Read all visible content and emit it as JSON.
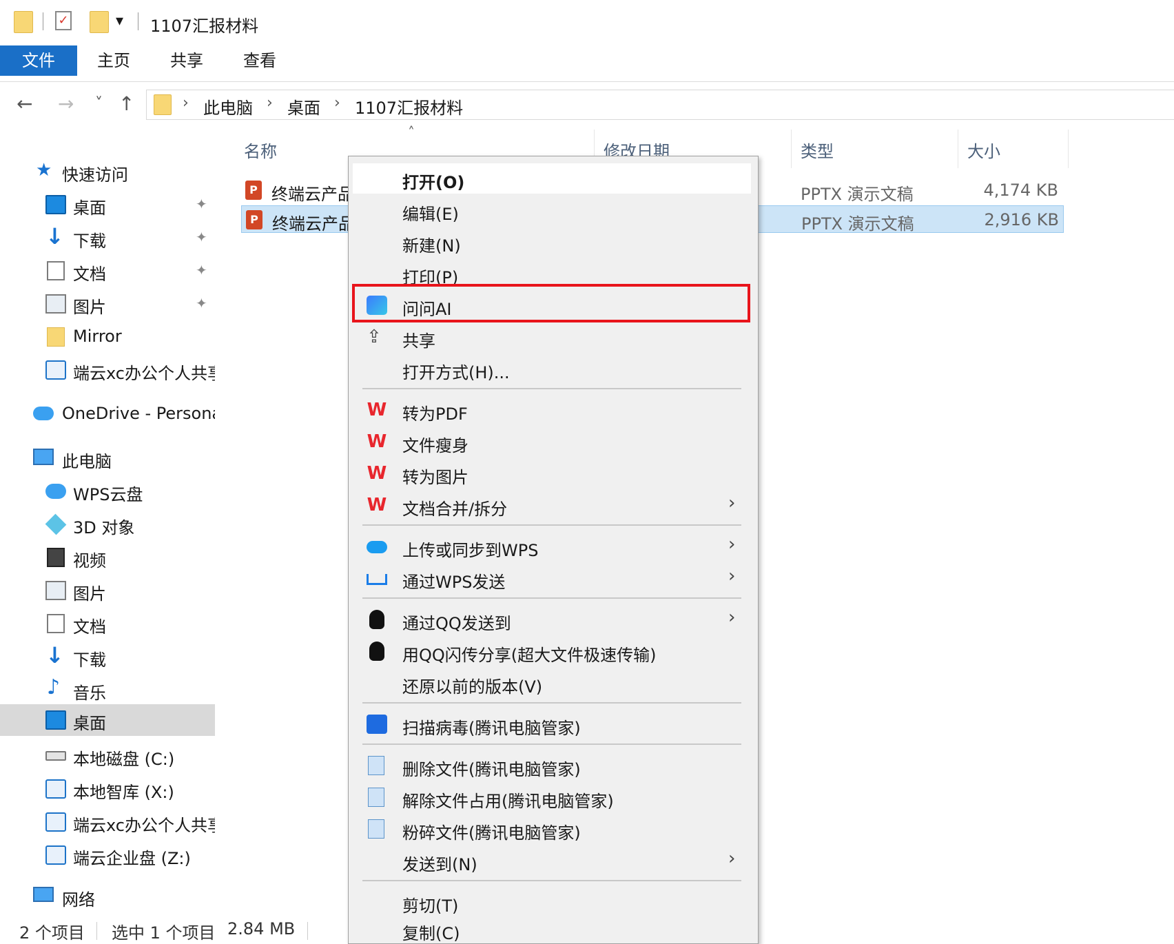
{
  "window": {
    "title": "1107汇报材料"
  },
  "ribbon": {
    "tabs": [
      {
        "label": "文件"
      },
      {
        "label": "主页"
      },
      {
        "label": "共享"
      },
      {
        "label": "查看"
      }
    ]
  },
  "address": {
    "crumbs": [
      "此电脑",
      "桌面",
      "1107汇报材料"
    ]
  },
  "navpane": {
    "quick_access": "快速访问",
    "quick_items": [
      {
        "label": "桌面",
        "icon": "desktop-icon"
      },
      {
        "label": "下载",
        "icon": "download-icon"
      },
      {
        "label": "文档",
        "icon": "document-icon"
      },
      {
        "label": "图片",
        "icon": "picture-icon"
      },
      {
        "label": "Mirror",
        "icon": "folder-icon"
      },
      {
        "label": "端云xc办公个人共享",
        "icon": "network-drive-icon"
      }
    ],
    "onedrive": "OneDrive - Personal",
    "this_pc": "此电脑",
    "pc_items": [
      {
        "label": "WPS云盘",
        "icon": "cloud-icon"
      },
      {
        "label": "3D 对象",
        "icon": "3d-objects-icon"
      },
      {
        "label": "视频",
        "icon": "video-icon"
      },
      {
        "label": "图片",
        "icon": "picture-icon"
      },
      {
        "label": "文档",
        "icon": "document-icon"
      },
      {
        "label": "下载",
        "icon": "download-icon"
      },
      {
        "label": "音乐",
        "icon": "music-icon"
      },
      {
        "label": "桌面",
        "icon": "desktop-icon"
      },
      {
        "label": "本地磁盘 (C:)",
        "icon": "disk-icon"
      },
      {
        "label": "本地智库 (X:)",
        "icon": "network-drive-icon"
      },
      {
        "label": "端云xc办公个人共享",
        "icon": "network-drive-icon"
      },
      {
        "label": "端云企业盘 (Z:)",
        "icon": "network-drive-icon"
      }
    ],
    "network": "网络"
  },
  "filelist": {
    "columns": {
      "name": "名称",
      "date": "修改日期",
      "type": "类型",
      "size": "大小"
    },
    "rows": [
      {
        "name": "终端云产品",
        "type": "PPTX 演示文稿",
        "size": "4,174 KB",
        "icon_text": "P"
      },
      {
        "name": "终端云产品",
        "type": "PPTX 演示文稿",
        "size": "2,916 KB",
        "icon_text": "P"
      }
    ]
  },
  "status": {
    "count": "2 个项目",
    "selected": "选中 1 个项目",
    "size": "2.84 MB"
  },
  "context_menu": {
    "items": [
      {
        "label": "打开(O)",
        "bold": true
      },
      {
        "label": "编辑(E)"
      },
      {
        "label": "新建(N)"
      },
      {
        "label": "打印(P)"
      },
      {
        "label": "问问AI",
        "icon": "ai-icon"
      },
      {
        "label": "共享",
        "icon": "share-icon"
      },
      {
        "label": "打开方式(H)..."
      },
      {
        "label": "转为PDF",
        "icon": "wps-icon"
      },
      {
        "label": "文件瘦身",
        "icon": "wps-icon"
      },
      {
        "label": "转为图片",
        "icon": "wps-icon"
      },
      {
        "label": "文档合并/拆分",
        "icon": "wps-icon",
        "submenu": true
      },
      {
        "label": "上传或同步到WPS",
        "icon": "wps-cloud-icon",
        "submenu": true
      },
      {
        "label": "通过WPS发送",
        "icon": "wps-send-icon",
        "submenu": true
      },
      {
        "label": "通过QQ发送到",
        "icon": "qq-icon",
        "submenu": true
      },
      {
        "label": "用QQ闪传分享(超大文件极速传输)",
        "icon": "qq-icon"
      },
      {
        "label": "还原以前的版本(V)"
      },
      {
        "label": "扫描病毒(腾讯电脑管家)",
        "icon": "shield-icon"
      },
      {
        "label": "删除文件(腾讯电脑管家)",
        "icon": "tencent-delete-icon"
      },
      {
        "label": "解除文件占用(腾讯电脑管家)",
        "icon": "tencent-unlock-icon"
      },
      {
        "label": "粉碎文件(腾讯电脑管家)",
        "icon": "tencent-shred-icon"
      },
      {
        "label": "发送到(N)",
        "submenu": true
      },
      {
        "label": "剪切(T)"
      },
      {
        "label": "复制(C)"
      }
    ],
    "submenu_glyph": "›",
    "wps_glyph": "W"
  },
  "glyphs": {
    "back": "←",
    "forward": "→",
    "down": "˅",
    "up": "↑",
    "crumb_sep": "›",
    "sort": "˄",
    "pin": "📌",
    "dropdown": "▾"
  },
  "colors": {
    "accent": "#1a6fc7",
    "highlight": "#e8141b",
    "selection": "#cce4f7"
  }
}
